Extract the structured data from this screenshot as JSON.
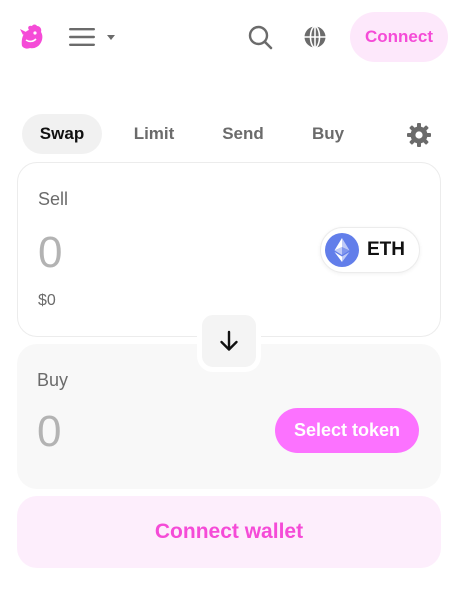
{
  "header": {
    "logo_icon": "uniswap-unicorn-logo",
    "menu_icon": "hamburger-menu-icon",
    "search_icon": "search-icon",
    "globe_icon": "globe-icon",
    "connect_label": "Connect"
  },
  "tabs": [
    {
      "label": "Swap",
      "active": true
    },
    {
      "label": "Limit",
      "active": false
    },
    {
      "label": "Send",
      "active": false
    },
    {
      "label": "Buy",
      "active": false
    }
  ],
  "sell": {
    "label": "Sell",
    "amount": "0",
    "usd_value": "$0",
    "token": {
      "symbol": "ETH",
      "icon": "eth-icon"
    }
  },
  "buy": {
    "label": "Buy",
    "amount": "0",
    "select_token_label": "Select token"
  },
  "connect_wallet_label": "Connect wallet",
  "colors": {
    "accent": "#fc72ff",
    "accent_text": "#f54bd7",
    "accent_soft": "#fde8fb",
    "eth_blue": "#627eea"
  }
}
